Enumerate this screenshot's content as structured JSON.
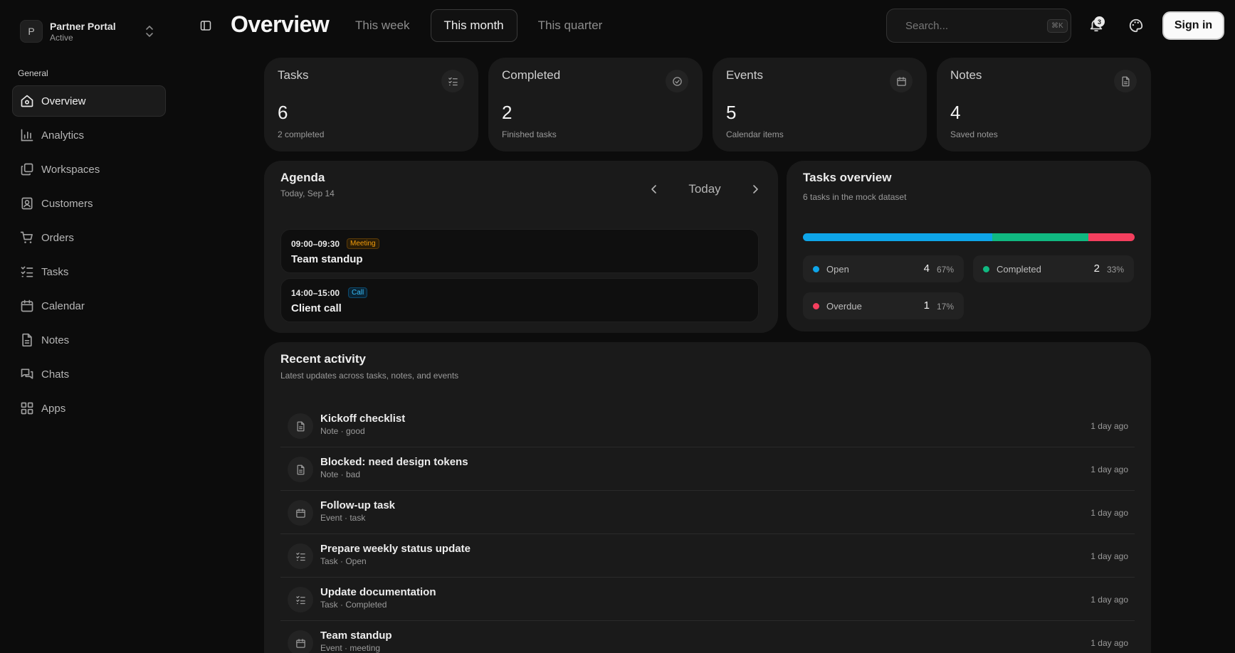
{
  "workspace": {
    "initial": "P",
    "name": "Partner Portal",
    "status": "Active"
  },
  "sidebar": {
    "group_label": "General",
    "items": [
      {
        "label": "Overview",
        "icon": "home-icon",
        "active": true
      },
      {
        "label": "Analytics",
        "icon": "bar-chart-icon"
      },
      {
        "label": "Workspaces",
        "icon": "workspaces-icon"
      },
      {
        "label": "Customers",
        "icon": "contact-card-icon"
      },
      {
        "label": "Orders",
        "icon": "cart-icon"
      },
      {
        "label": "Tasks",
        "icon": "checklist-icon"
      },
      {
        "label": "Calendar",
        "icon": "calendar-icon"
      },
      {
        "label": "Notes",
        "icon": "document-icon"
      },
      {
        "label": "Chats",
        "icon": "chat-icon"
      },
      {
        "label": "Apps",
        "icon": "grid-icon"
      }
    ]
  },
  "header": {
    "title": "Overview",
    "tabs": [
      {
        "label": "This week"
      },
      {
        "label": "This month",
        "active": true
      },
      {
        "label": "This quarter"
      }
    ],
    "search": {
      "placeholder": "Search...",
      "shortcut": "⌘K"
    },
    "notifications_count": "3",
    "signin_label": "Sign in"
  },
  "stats": [
    {
      "title": "Tasks",
      "value": "6",
      "sub": "2 completed",
      "icon": "checklist-icon"
    },
    {
      "title": "Completed",
      "value": "2",
      "sub": "Finished tasks",
      "icon": "check-circle-icon"
    },
    {
      "title": "Events",
      "value": "5",
      "sub": "Calendar items",
      "icon": "calendar-icon"
    },
    {
      "title": "Notes",
      "value": "4",
      "sub": "Saved notes",
      "icon": "document-icon"
    }
  ],
  "agenda": {
    "title": "Agenda",
    "date": "Today, Sep 14",
    "today_label": "Today",
    "events": [
      {
        "time": "09:00–09:30",
        "tag": "Meeting",
        "title": "Team standup"
      },
      {
        "time": "14:00–15:00",
        "tag": "Call",
        "title": "Client call"
      }
    ]
  },
  "tasks_overview": {
    "title": "Tasks overview",
    "subtitle": "6 tasks in the mock dataset",
    "segments": [
      {
        "label": "Open",
        "count": "4",
        "pct": "67%",
        "fraction": 0.57,
        "color": "#0ea5e9"
      },
      {
        "label": "Completed",
        "count": "2",
        "pct": "33%",
        "fraction": 0.29,
        "color": "#10b981"
      },
      {
        "label": "Overdue",
        "count": "1",
        "pct": "17%",
        "fraction": 0.14,
        "color": "#f43f5e"
      }
    ]
  },
  "activity": {
    "title": "Recent activity",
    "subtitle": "Latest updates across tasks, notes, and events",
    "items": [
      {
        "title": "Kickoff checklist",
        "meta": "Note · good",
        "time": "1 day ago",
        "icon": "document-icon"
      },
      {
        "title": "Blocked: need design tokens",
        "meta": "Note · bad",
        "time": "1 day ago",
        "icon": "document-icon"
      },
      {
        "title": "Follow-up task",
        "meta": "Event · task",
        "time": "1 day ago",
        "icon": "calendar-icon"
      },
      {
        "title": "Prepare weekly status update",
        "meta": "Task · Open",
        "time": "1 day ago",
        "icon": "checklist-icon"
      },
      {
        "title": "Update documentation",
        "meta": "Task · Completed",
        "time": "1 day ago",
        "icon": "checklist-icon"
      },
      {
        "title": "Team standup",
        "meta": "Event · meeting",
        "time": "1 day ago",
        "icon": "calendar-icon"
      }
    ]
  },
  "colors": {
    "background": "#0c0c0c",
    "card": "#1a1a1a",
    "meeting_tag": "#f59e0b",
    "call_tag": "#38bdf8"
  }
}
